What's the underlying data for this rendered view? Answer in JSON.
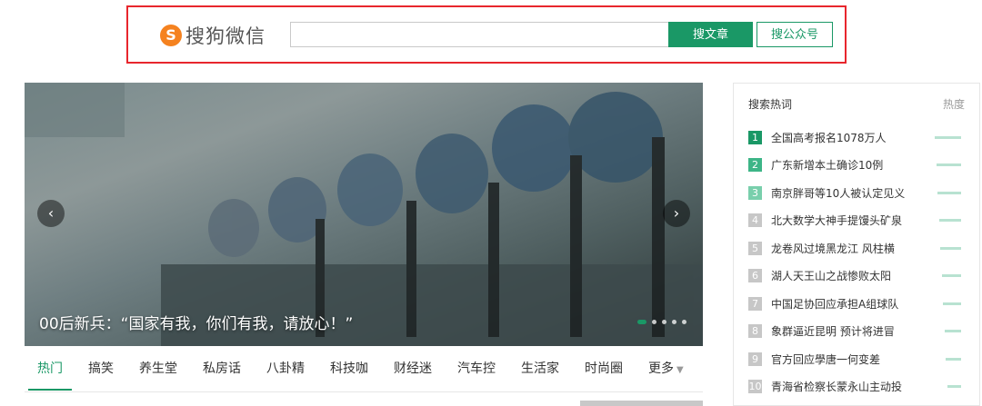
{
  "header": {
    "logo_text": "搜狗微信",
    "logo_icon": "sogou-logo-icon",
    "search_placeholder": "",
    "search_article_label": "搜文章",
    "search_account_label": "搜公众号",
    "accent_color": "#1a9866",
    "highlight_color": "#e8262d"
  },
  "carousel": {
    "caption": "00后新兵：“国家有我，你们有我，请放心！”",
    "prev_icon": "chevron-left-icon",
    "next_icon": "chevron-right-icon",
    "slide_count": 5,
    "active_slide": 1
  },
  "nav": {
    "items": [
      {
        "label": "热门",
        "active": true
      },
      {
        "label": "搞笑"
      },
      {
        "label": "养生堂"
      },
      {
        "label": "私房话"
      },
      {
        "label": "八卦精"
      },
      {
        "label": "科技咖"
      },
      {
        "label": "财经迷"
      },
      {
        "label": "汽车控"
      },
      {
        "label": "生活家"
      },
      {
        "label": "时尚圈"
      },
      {
        "label": "更多"
      }
    ]
  },
  "hot": {
    "title": "搜索热词",
    "heat_label": "热度",
    "items": [
      {
        "rank": "1",
        "title": "全国高考报名1078万人",
        "heat": 0.95
      },
      {
        "rank": "2",
        "title": "广东新增本土确诊10例",
        "heat": 0.9
      },
      {
        "rank": "3",
        "title": "南京胖哥等10人被认定见义",
        "heat": 0.85
      },
      {
        "rank": "4",
        "title": "北大数学大神手提馒头矿泉",
        "heat": 0.8
      },
      {
        "rank": "5",
        "title": "龙卷风过境黑龙江 风柱横",
        "heat": 0.75
      },
      {
        "rank": "6",
        "title": "湖人天王山之战惨败太阳",
        "heat": 0.7
      },
      {
        "rank": "7",
        "title": "中国足协回应承担A组球队",
        "heat": 0.65
      },
      {
        "rank": "8",
        "title": "象群逼近昆明 预计将进冒",
        "heat": 0.6
      },
      {
        "rank": "9",
        "title": "官方回应學唐一何变差",
        "heat": 0.55
      },
      {
        "rank": "10",
        "title": "青海省检察长蒙永山主动投",
        "heat": 0.5
      }
    ]
  }
}
